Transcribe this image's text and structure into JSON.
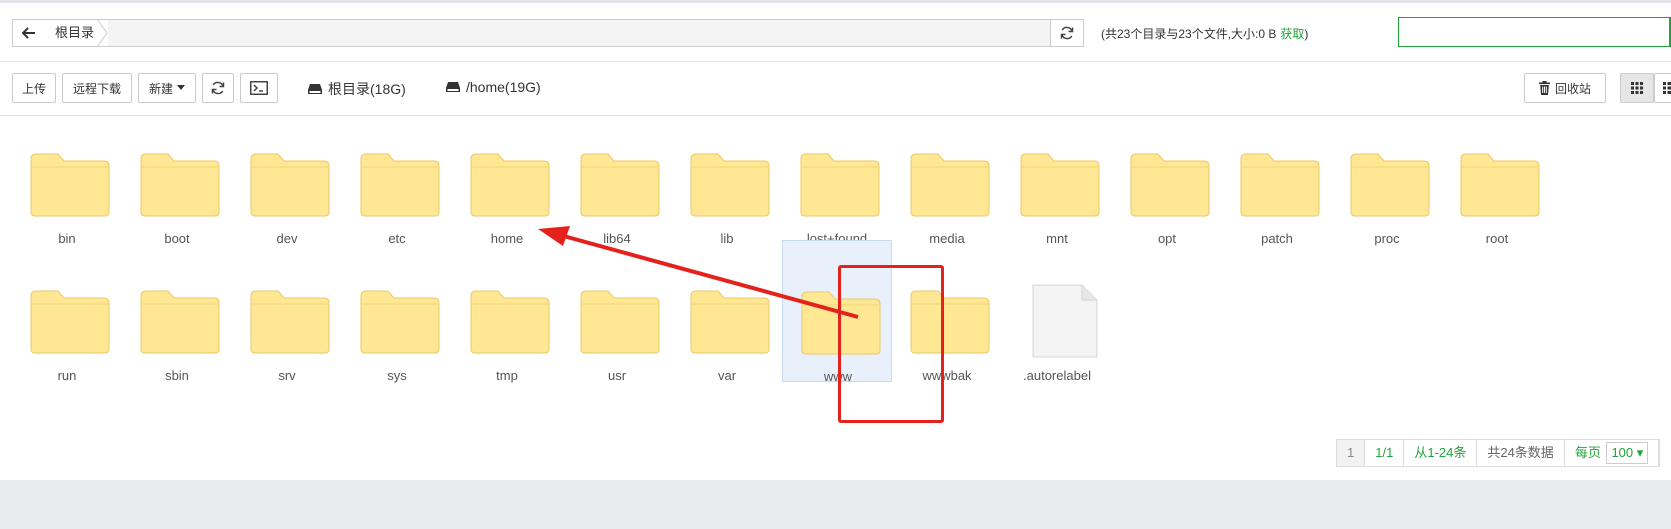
{
  "path": {
    "crumb": "根目录",
    "summary_text": "(共23个目录与23个文件,大小:0 B",
    "fetch_label": "获取",
    "summary_close": ")"
  },
  "toolbar": {
    "upload": "上传",
    "remote_download": "远程下载",
    "new": "新建",
    "disk_root": "根目录(18G)",
    "disk_home": "/home(19G)",
    "recycle": "回收站"
  },
  "items": [
    {
      "name": "bin",
      "type": "folder"
    },
    {
      "name": "boot",
      "type": "folder"
    },
    {
      "name": "dev",
      "type": "folder"
    },
    {
      "name": "etc",
      "type": "folder"
    },
    {
      "name": "home",
      "type": "folder"
    },
    {
      "name": "lib64",
      "type": "folder"
    },
    {
      "name": "lib",
      "type": "folder"
    },
    {
      "name": "lost+found",
      "type": "folder"
    },
    {
      "name": "media",
      "type": "folder"
    },
    {
      "name": "mnt",
      "type": "folder"
    },
    {
      "name": "opt",
      "type": "folder"
    },
    {
      "name": "patch",
      "type": "folder"
    },
    {
      "name": "proc",
      "type": "folder"
    },
    {
      "name": "root",
      "type": "folder"
    },
    {
      "name": "run",
      "type": "folder"
    },
    {
      "name": "sbin",
      "type": "folder"
    },
    {
      "name": "srv",
      "type": "folder"
    },
    {
      "name": "sys",
      "type": "folder"
    },
    {
      "name": "tmp",
      "type": "folder"
    },
    {
      "name": "usr",
      "type": "folder"
    },
    {
      "name": "var",
      "type": "folder"
    },
    {
      "name": "www",
      "type": "folder",
      "selected": true
    },
    {
      "name": "wwwbak",
      "type": "folder"
    },
    {
      "name": ".autorelabel",
      "type": "file"
    }
  ],
  "pager": {
    "current": "1",
    "pages": "1/1",
    "range": "从1-24条",
    "total": "共24条数据",
    "per_page_label": "每页",
    "per_page_value": "100"
  },
  "colors": {
    "accent": "#20a53a",
    "folder": "#ffe793",
    "annotation": "#e5211c"
  }
}
